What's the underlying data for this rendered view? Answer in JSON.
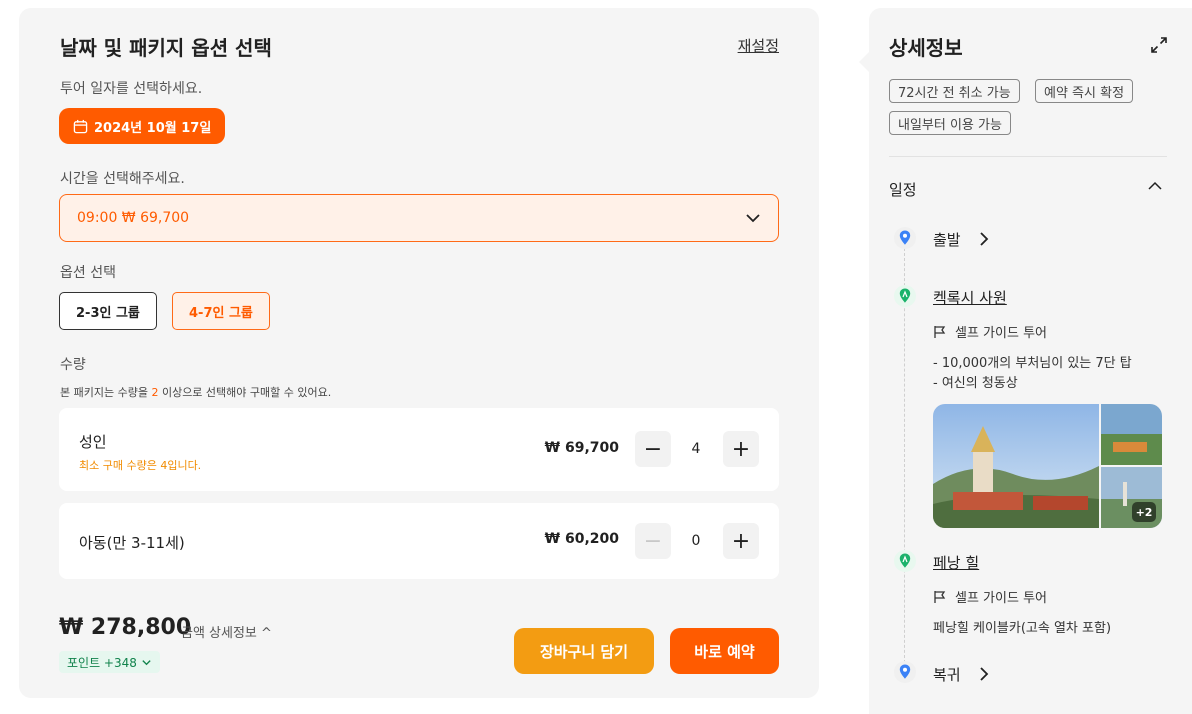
{
  "booking": {
    "title": "날짜 및 패키지 옵션 선택",
    "reset_label": "재설정",
    "date_prompt": "투어 일자를 선택하세요.",
    "date_value": "2024년 10월 17일",
    "time_prompt": "시간을 선택해주세요.",
    "time_value": "09:00 ₩ 69,700",
    "option_prompt": "옵션 선택",
    "options": [
      {
        "label": "2-3인 그룹",
        "selected": false
      },
      {
        "label": "4-7인 그룹",
        "selected": true
      }
    ],
    "quantity_prompt": "수량",
    "quantity_note_before": "본 패키지는 수량을 ",
    "quantity_note_min": "2",
    "quantity_note_after": " 이상으로 선택해야 구매할 수 있어요.",
    "rows": [
      {
        "name": "성인",
        "note": "최소 구매 수량은 4입니다.",
        "price": "₩ 69,700",
        "qty": "4",
        "minus_label": "−",
        "plus_label": "+"
      },
      {
        "name": "아동(만 3-11세)",
        "note": "",
        "price": "₩ 60,200",
        "qty": "0",
        "minus_label": "−",
        "plus_label": "+"
      }
    ],
    "total": "₩ 278,800",
    "detail_label": "금액 상세정보 ^",
    "points_label": "포인트 +348",
    "cart_label": "장바구니 담기",
    "book_label": "바로 예약",
    "colors": {
      "accent": "#ff5b00",
      "cart": "#f39c12",
      "points_green": "#11834c"
    }
  },
  "details": {
    "title": "상세정보",
    "tags": [
      "72시간 전 취소 가능",
      "예약 즉시 확정",
      "내일부터 이용 가능"
    ],
    "itinerary_title": "일정",
    "stops": [
      {
        "title": "출발",
        "icon": "location-pin-icon"
      },
      {
        "title": "켁록시 사원",
        "icon": "attraction-pin-icon",
        "guide": "셀프 가이드 투어",
        "desc": [
          "- 10,000개의 부처님이 있는 7단 탑",
          "- 여신의 청동상"
        ],
        "more_photos": "+2"
      },
      {
        "title": "페낭 힐",
        "icon": "attraction-pin-icon",
        "guide": "셀프 가이드 투어",
        "desc": [
          "페낭힐 케이블카(고속 열차 포함)"
        ]
      },
      {
        "title": "복귀",
        "icon": "location-pin-icon"
      }
    ]
  }
}
